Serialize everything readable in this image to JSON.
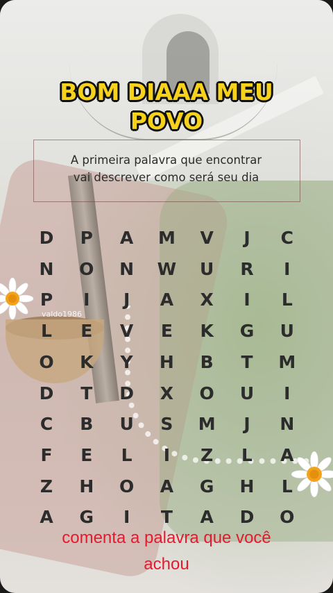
{
  "title": {
    "line1": "BOM DIAAA MEU",
    "line2": "POVO"
  },
  "subtitle": {
    "line1": "A primeira palavra que encontrar",
    "line2": "vai descrever como será seu dia"
  },
  "watermark": "valdo1986",
  "grid": [
    [
      "D",
      "P",
      "A",
      "M",
      "V",
      "J",
      "C"
    ],
    [
      "N",
      "O",
      "N",
      "W",
      "U",
      "R",
      "I"
    ],
    [
      "P",
      "I",
      "J",
      "A",
      "X",
      "I",
      "L"
    ],
    [
      "L",
      "E",
      "V",
      "E",
      "K",
      "G",
      "U"
    ],
    [
      "O",
      "K",
      "Y",
      "H",
      "B",
      "T",
      "M"
    ],
    [
      "D",
      "T",
      "D",
      "X",
      "O",
      "U",
      "I"
    ],
    [
      "C",
      "B",
      "U",
      "S",
      "M",
      "J",
      "N"
    ],
    [
      "F",
      "E",
      "L",
      "I",
      "Z",
      "L",
      "A"
    ],
    [
      "Z",
      "H",
      "O",
      "A",
      "G",
      "H",
      "L"
    ],
    [
      "A",
      "G",
      "I",
      "T",
      "A",
      "D",
      "O"
    ]
  ],
  "footer": {
    "line1": "comenta a palavra que você",
    "line2": "achou"
  },
  "colors": {
    "title_fill": "#f7d21d",
    "title_outline": "#111111",
    "letters": "#2c2c2c",
    "footer_text": "#e21b2f"
  },
  "icons": [
    "daisy-flower-icon"
  ]
}
